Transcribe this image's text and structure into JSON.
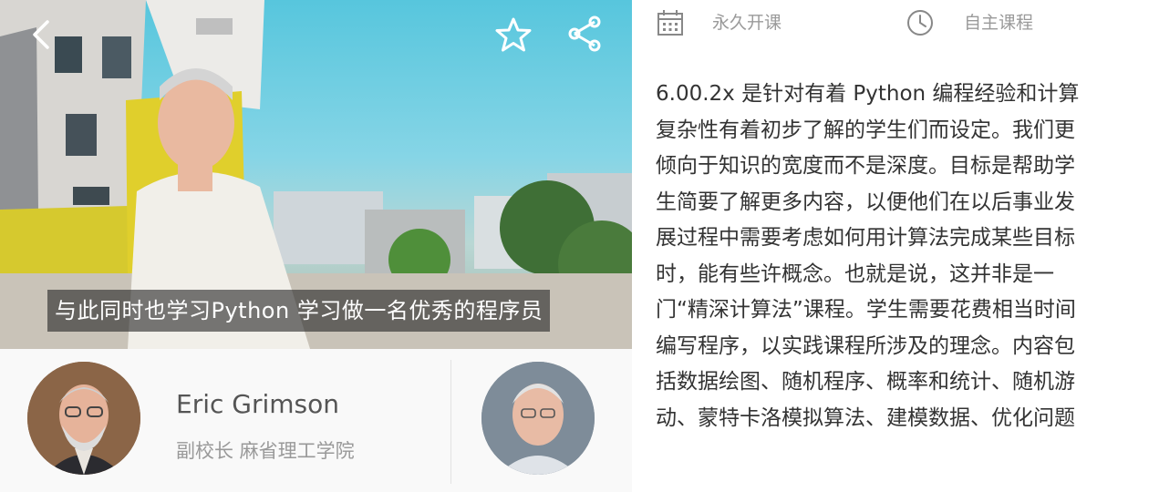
{
  "player": {
    "subtitle": "与此同时也学习Python 学习做一名优秀的程序员",
    "controls": {
      "back_icon": "chevron-left-icon",
      "favorite_icon": "star-outline-icon",
      "share_icon": "share-icon"
    }
  },
  "instructors": [
    {
      "name": "Eric Grimson",
      "title": "副校长 麻省理工学院"
    },
    {
      "name": "",
      "title": ""
    }
  ],
  "course_meta": {
    "start_label": "永久开课",
    "start_icon": "calendar-icon",
    "pace_label": "自主课程",
    "pace_icon": "clock-icon"
  },
  "description_lines": [
    "6.00.2x 是针对有着 Python 编程经验和计算",
    "复杂性有着初步了解的学生们而设定。我们更",
    "倾向于知识的宽度而不是深度。目标是帮助学",
    "生简要了解更多内容，以便他们在以后事业发",
    "展过程中需要考虑如何用计算法完成某些目标",
    "时，能有些许概念。也就是说，这并非是一",
    "门“精深计算法”课程。学生需要花费相当时间",
    "编写程序，以实践课程所涉及的理念。内容包",
    "括数据绘图、随机程序、概率和统计、随机游",
    "动、蒙特卡洛模拟算法、建模数据、优化问题"
  ]
}
